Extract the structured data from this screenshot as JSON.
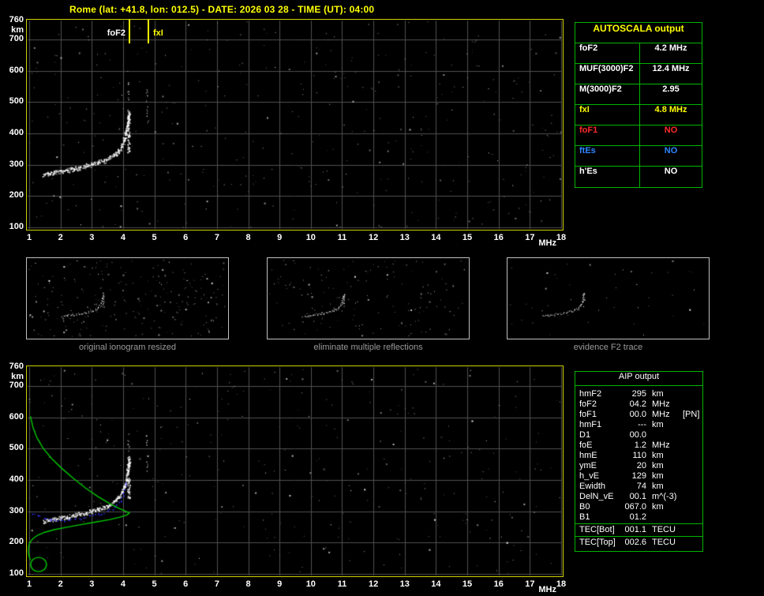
{
  "header": {
    "title": "Rome (lat: +41.8, lon: 012.5) - DATE: 2026 03 28 - TIME (UT): 04:00"
  },
  "colors": {
    "background": "#000000",
    "plot_border": "#d0d000",
    "grid": "#505050",
    "title_text": "#ffff00",
    "axis_text": "#ffffff",
    "table_border_green": "#00b400",
    "thumb_border": "#c0c0c0",
    "caption_text": "#9a9a9a",
    "trace_white": "#ffffff",
    "profile_green": "#00c800",
    "restored_blue": "#3232ff",
    "marker_yellow": "#ffff00",
    "no_red": "#ff2a2a",
    "es_blue": "#2e86ff"
  },
  "autoscala": {
    "title": "AUTOSCALA output",
    "rows": [
      {
        "label": "foF2",
        "value": "4.2 MHz",
        "color": "#ffffff"
      },
      {
        "label": "MUF(3000)F2",
        "value": "12.4 MHz",
        "color": "#ffffff"
      },
      {
        "label": "M(3000)F2",
        "value": "2.95",
        "color": "#ffffff"
      },
      {
        "label": "fxI",
        "value": "4.8 MHz",
        "color": "#ffff00"
      },
      {
        "label": "foF1",
        "value": "NO",
        "color": "#ff2a2a"
      },
      {
        "label": "ftEs",
        "value": "NO",
        "color": "#2e86ff"
      },
      {
        "label": "h'Es",
        "value": "NO",
        "color": "#ffffff"
      }
    ]
  },
  "aip": {
    "title": "AIP output",
    "rows": [
      {
        "label": "hmF2",
        "value": "295",
        "unit": "km",
        "extra": ""
      },
      {
        "label": "foF2",
        "value": "04.2",
        "unit": "MHz",
        "extra": ""
      },
      {
        "label": "foF1",
        "value": "00.0",
        "unit": "MHz",
        "extra": "[PN]"
      },
      {
        "label": "hmF1",
        "value": "---",
        "unit": "km",
        "extra": ""
      },
      {
        "label": "D1",
        "value": "00.0",
        "unit": "",
        "extra": ""
      },
      {
        "label": "foE",
        "value": "1.2",
        "unit": "MHz",
        "extra": ""
      },
      {
        "label": "hmE",
        "value": "110",
        "unit": "km",
        "extra": ""
      },
      {
        "label": "ymE",
        "value": "20",
        "unit": "km",
        "extra": ""
      },
      {
        "label": "h_vE",
        "value": "129",
        "unit": "km",
        "extra": ""
      },
      {
        "label": "Ewidth",
        "value": "74",
        "unit": "km",
        "extra": ""
      },
      {
        "label": "DelN_vE",
        "value": "00.1",
        "unit": "m^(-3)",
        "extra": ""
      },
      {
        "label": "B0",
        "value": "067.0",
        "unit": "km",
        "extra": ""
      },
      {
        "label": "B1",
        "value": "01.2",
        "unit": "",
        "extra": ""
      },
      {
        "label": "TEC[Bot]",
        "value": "001.1",
        "unit": "TECU",
        "extra": "",
        "sep_before": true
      },
      {
        "label": "TEC[Top]",
        "value": "002.6",
        "unit": "TECU",
        "extra": "",
        "sep_before": true
      }
    ]
  },
  "thumbnails": [
    {
      "caption": "original ionogram resized"
    },
    {
      "caption": "eliminate multiple reflections"
    },
    {
      "caption": "evidence F2 trace"
    }
  ],
  "chart_data": {
    "type": "scatter",
    "title": "ionogram virtual height vs frequency",
    "xlabel": "MHz",
    "ylabel": "km",
    "xlim": [
      1,
      18
    ],
    "ylim": [
      100,
      760
    ],
    "grid": true,
    "xticks": [
      1,
      2,
      3,
      4,
      5,
      6,
      7,
      8,
      9,
      10,
      11,
      12,
      13,
      14,
      15,
      16,
      17,
      18
    ],
    "yticks": [
      760,
      700,
      600,
      500,
      400,
      300,
      200,
      100
    ],
    "markers": [
      {
        "name": "foF2",
        "mhz": 4.2,
        "color": "#ffffff"
      },
      {
        "name": "fxI",
        "mhz": 4.8,
        "color": "#ffff00"
      }
    ],
    "f2_trace": [
      [
        1.45,
        270
      ],
      [
        1.6,
        273
      ],
      [
        1.8,
        276
      ],
      [
        2.0,
        280
      ],
      [
        2.2,
        283
      ],
      [
        2.4,
        287
      ],
      [
        2.6,
        291
      ],
      [
        2.8,
        296
      ],
      [
        3.0,
        301
      ],
      [
        3.2,
        307
      ],
      [
        3.4,
        314
      ],
      [
        3.55,
        322
      ],
      [
        3.7,
        331
      ],
      [
        3.85,
        344
      ],
      [
        3.95,
        360
      ],
      [
        4.03,
        380
      ],
      [
        4.09,
        403
      ],
      [
        4.13,
        425
      ],
      [
        4.16,
        447
      ],
      [
        4.18,
        465
      ]
    ],
    "asymptote": {
      "mhz": 4.17,
      "km_min": 340,
      "km_max": 480
    },
    "x_trace_column": {
      "mhz": 4.76,
      "km_min": 420,
      "km_max": 545
    },
    "profile_green": [
      [
        1.04,
        603
      ],
      [
        1.12,
        568
      ],
      [
        1.25,
        534
      ],
      [
        1.45,
        500
      ],
      [
        1.72,
        468
      ],
      [
        2.05,
        436
      ],
      [
        2.42,
        404
      ],
      [
        2.8,
        374
      ],
      [
        3.18,
        348
      ],
      [
        3.55,
        326
      ],
      [
        3.85,
        310
      ],
      [
        4.08,
        300
      ],
      [
        4.2,
        295
      ],
      [
        4.12,
        288
      ],
      [
        3.9,
        281
      ],
      [
        3.55,
        273
      ],
      [
        3.1,
        265
      ],
      [
        2.65,
        257
      ],
      [
        2.2,
        249
      ],
      [
        1.8,
        241
      ],
      [
        1.5,
        233
      ],
      [
        1.28,
        224
      ],
      [
        1.12,
        213
      ],
      [
        1.03,
        201
      ],
      [
        0.98,
        188
      ],
      [
        0.97,
        173
      ],
      [
        0.99,
        158
      ],
      [
        1.04,
        145
      ]
    ],
    "e_layer_ellipse": {
      "mhz": 1.3,
      "km": 130,
      "rx_mhz": 0.26,
      "ry_km": 22
    },
    "restored_trace_blue": [
      [
        1.08,
        293
      ],
      [
        1.25,
        286
      ],
      [
        1.45,
        280
      ],
      [
        1.7,
        275
      ],
      [
        2.0,
        272
      ],
      [
        2.3,
        274
      ],
      [
        2.6,
        278
      ],
      [
        2.9,
        284
      ],
      [
        3.2,
        291
      ],
      [
        3.5,
        301
      ],
      [
        3.72,
        314
      ],
      [
        3.9,
        334
      ],
      [
        4.02,
        360
      ],
      [
        4.1,
        390
      ]
    ],
    "panels": [
      {
        "id": "top",
        "noise": 400,
        "seed": 7
      },
      {
        "id": "bottom",
        "noise": 340,
        "seed": 13
      },
      {
        "id": "thumb0",
        "noise": 240,
        "seed": 21
      },
      {
        "id": "thumb1",
        "noise": 150,
        "seed": 22
      },
      {
        "id": "thumb2",
        "noise": 45,
        "seed": 23
      }
    ]
  }
}
